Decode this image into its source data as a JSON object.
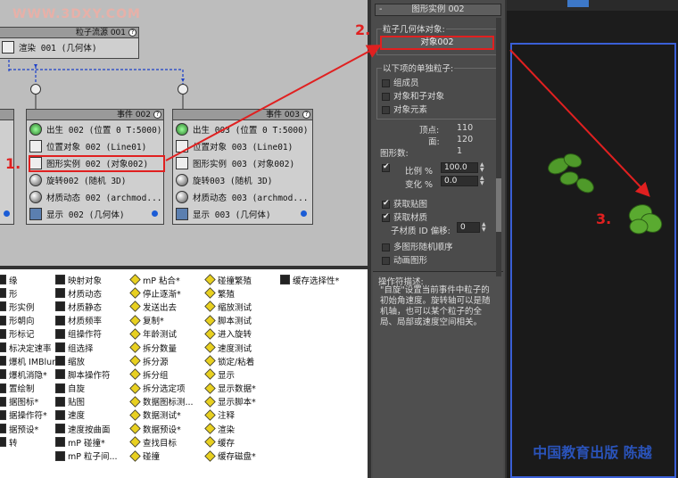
{
  "watermark": "WWW.3DXY.COM",
  "source_node": {
    "title": "粒子流源 001",
    "row": "渲染 001 (几何体)"
  },
  "event2": {
    "title": "事件 002",
    "rows": [
      "出生 002 (位置 0 T:5000)",
      "位置对象 002 (Line01)",
      "图形实例 002 (对象002)",
      "旋转002 (随机 3D)",
      "材质动态 002 (archmod...",
      "显示 002 (几何体)"
    ]
  },
  "event3": {
    "title": "事件 003",
    "rows": [
      "出生 003 (位置 0 T:5000)",
      "位置对象 003 (Line01)",
      "图形实例 003 (对象002)",
      "旋转003 (随机 3D)",
      "材质动态 003 (archmod...",
      "显示 003 (几何体)"
    ]
  },
  "annotations": {
    "a1": "1.",
    "a2": "2.",
    "a3": "3."
  },
  "operators": {
    "col1": [
      "缘",
      "形",
      "形实例",
      "形朝向",
      "形标记",
      "标决定速率",
      "爆机 IMBlur*",
      "爆机消隐*",
      "置绘制",
      "据图标*",
      "据操作符*",
      "据预设*",
      "转"
    ],
    "col2": [
      "映射对象",
      "材质动态",
      "材质静态",
      "材质频率",
      "组操作符",
      "组选择",
      "缩放",
      "脚本操作符",
      "自旋",
      "贴图",
      "速度",
      "速度按曲面",
      "mP 碰撞*",
      "mP 粒子间..."
    ],
    "col3": [
      "mP 粘合*",
      "停止逐渐*",
      "发送出去",
      "复制*",
      "年龄测试",
      "拆分数量",
      "拆分源",
      "拆分组",
      "拆分选定项",
      "数据图标测...",
      "数据测试*",
      "数据预设*",
      "查找目标",
      "碰撞"
    ],
    "col4": [
      "碰撞繁殖",
      "繁殖",
      "缩放测试",
      "脚本测试",
      "进入旋转",
      "速度测试",
      "锁定/粘着",
      "显示",
      "显示数据*",
      "显示脚本*",
      "注释",
      "渲染",
      "缓存",
      "缓存磁盘*"
    ],
    "col5": [
      "缓存选择性*"
    ]
  },
  "panel": {
    "title": "图形实例 002",
    "geom_label": "粒子几何体对象:",
    "geom_button": "对象002",
    "single_label": "以下项的单独粒子:",
    "opt1": "组成员",
    "opt2": "对象和子对象",
    "opt3": "对象元素",
    "vert_label": "顶点:",
    "vert_val": "110",
    "face_label": "面:",
    "face_val": "120",
    "shapes_label": "图形数:",
    "shapes_val": "1",
    "scale_label": "比例 %",
    "scale_val": "100.0",
    "var_label": "变化 %",
    "var_val": "0.0",
    "map_label": "获取贴图",
    "mtl_label": "获取材质",
    "offset_label": "子材质 ID 偏移:",
    "offset_val": "0",
    "multi_label": "多图形随机顺序",
    "anim_label": "动画图形",
    "desc_title": "操作符描述:",
    "desc_text": "\"自旋\"设置当前事件中粒子的初始角速度。旋转轴可以是随机轴，也可以某个粒子的全局、局部或速度空间相关。"
  },
  "viewport": {
    "logo": "中国教育出版 陈越"
  }
}
